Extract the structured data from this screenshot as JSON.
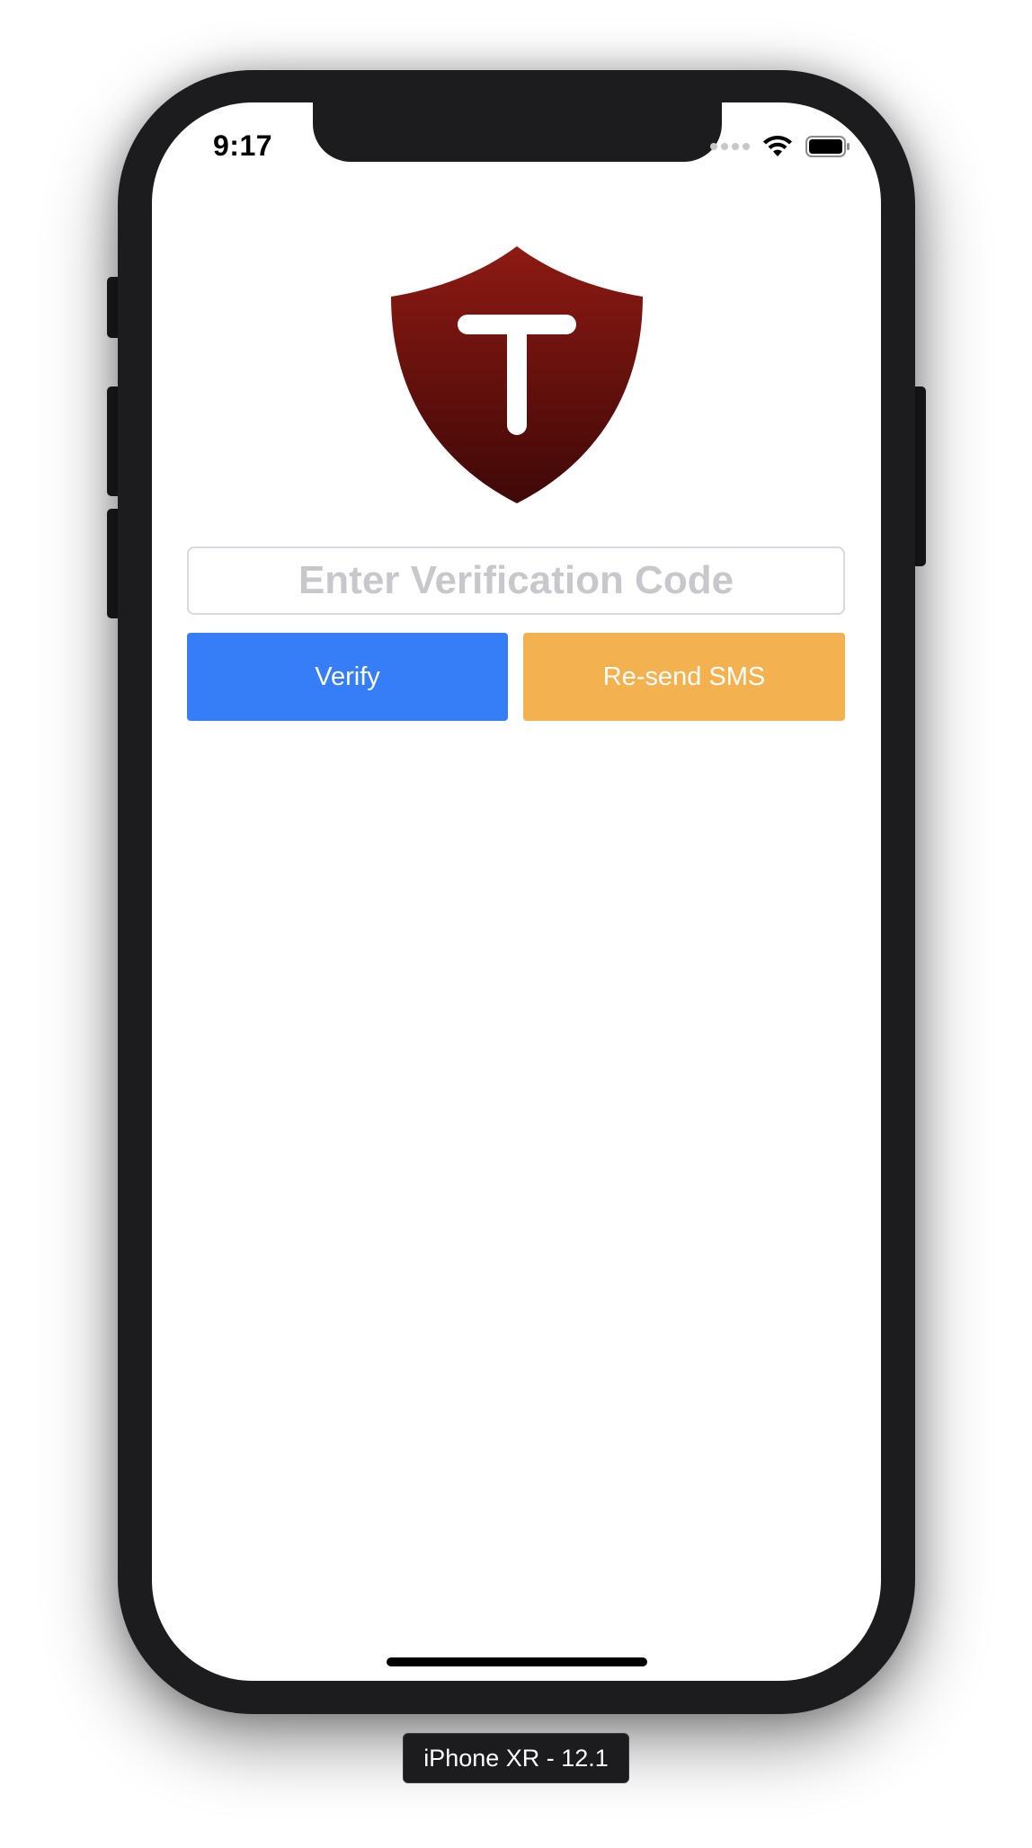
{
  "status_bar": {
    "time": "9:17"
  },
  "logo": {
    "letter": "T",
    "color_top": "#8e1a13",
    "color_bottom": "#3e0807"
  },
  "verification": {
    "placeholder": "Enter Verification Code",
    "value": ""
  },
  "buttons": {
    "verify_label": "Verify",
    "verify_color": "#357ef7",
    "resend_label": "Re-send SMS",
    "resend_color": "#f3b24f"
  },
  "device": {
    "label": "iPhone XR - 12.1"
  }
}
